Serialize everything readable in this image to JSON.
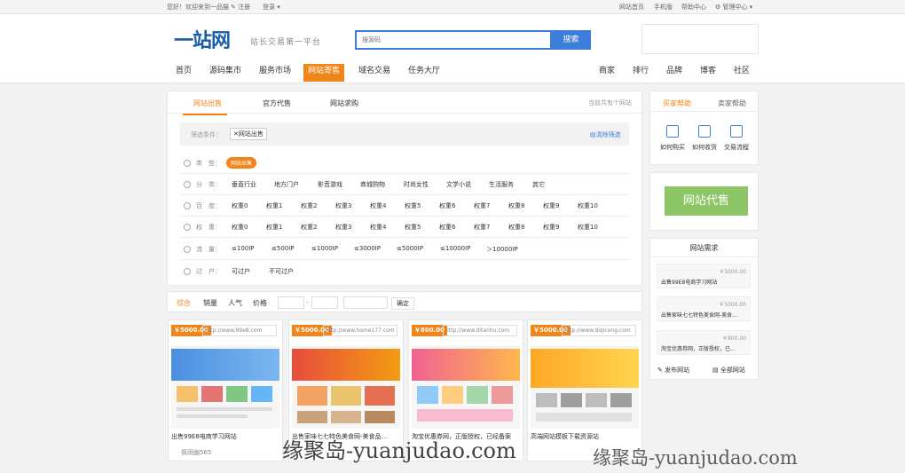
{
  "topbar": {
    "greeting": "您好！欢迎来到一品猫",
    "register": "注册",
    "login": "登录",
    "links": [
      "网站首页",
      "手机版",
      "帮助中心",
      "管理中心"
    ]
  },
  "header": {
    "logo": "一站网",
    "slogan": "站长交易第一平台",
    "search_placeholder": "搜源码",
    "search_button": "搜索",
    "nav_left": [
      "首页",
      "源码集市",
      "服务市场",
      "网站寄售",
      "域名交易",
      "任务大厅"
    ],
    "nav_right": [
      "商家",
      "排行",
      "品牌",
      "博客",
      "社区"
    ],
    "active_nav": "网站寄售"
  },
  "tabs": {
    "items": [
      "网站出售",
      "官方代售",
      "网站求购"
    ],
    "active": "网站出售",
    "count_text": "当前共有个网站"
  },
  "filters": {
    "label": "筛选条件：",
    "chip": "网站出售",
    "clear": "清除筛选",
    "rows": [
      {
        "label": "类　型：",
        "options": [
          "网站出售"
        ]
      },
      {
        "label": "分　类：",
        "options": [
          "垂直行业",
          "地方门户",
          "影音游戏",
          "商城购物",
          "时尚女性",
          "文学小说",
          "生活服务",
          "其它"
        ]
      },
      {
        "label": "百　度：",
        "options": [
          "权重0",
          "权重1",
          "权重2",
          "权重3",
          "权重4",
          "权重5",
          "权重6",
          "权重7",
          "权重8",
          "权重9",
          "权重10"
        ]
      },
      {
        "label": "权　重：",
        "options": [
          "权重0",
          "权重1",
          "权重2",
          "权重3",
          "权重4",
          "权重5",
          "权重6",
          "权重7",
          "权重8",
          "权重9",
          "权重10"
        ]
      },
      {
        "label": "流　量：",
        "options": [
          "≤100IP",
          "≤500IP",
          "≤1000IP",
          "≤3000IP",
          "≤5000IP",
          "≤10000IP",
          "＞10000IP"
        ]
      },
      {
        "label": "过　户：",
        "options": [
          "可过户",
          "不可过户"
        ]
      }
    ]
  },
  "sort": {
    "items": [
      "综合",
      "销量",
      "人气",
      "价格"
    ],
    "active": "综合",
    "dash": "-",
    "confirm": "确定"
  },
  "cards": [
    {
      "price": "￥5000.00",
      "url": "http://www.99e8.com",
      "title": "出售99E8电商学习网站",
      "seller": "佩雨幽565"
    },
    {
      "price": "￥5000.00",
      "url": "http://www.home177.com",
      "title": "出售家味七七特色美食网-美食品...",
      "seller": ""
    },
    {
      "price": "￥800.00",
      "url": "http://www.ditanhu.com",
      "title": "淘宝优惠券网，正版授权，已经备案",
      "seller": ""
    },
    {
      "price": "￥5000.00",
      "url": "http://www.diqiceng.com",
      "title": "高端网站模板下载资源站",
      "seller": ""
    }
  ],
  "sidebar": {
    "tabs": [
      "买家帮助",
      "卖家帮助"
    ],
    "help_items": [
      "如何购买",
      "如何收货",
      "交易流程"
    ],
    "daishou_button": "网站代售",
    "requests_title": "网站需求",
    "requests": [
      {
        "price": "￥5000.00",
        "title": "出售99E8电商学习网站"
      },
      {
        "price": "￥5000.00",
        "title": "出售家味七七特色美食网-美食..."
      },
      {
        "price": "￥800.00",
        "title": "淘宝优惠券网，正版授权，已..."
      }
    ],
    "publish": "发布网站",
    "all_sites": "全部网站"
  },
  "watermark": {
    "text1": "缘聚岛-yuanjudao.com",
    "text2": "缘聚岛-yuanjudao.com"
  },
  "colors": {
    "accent": "#f08519",
    "primary": "#3b7dd8",
    "green": "#8dc666"
  }
}
